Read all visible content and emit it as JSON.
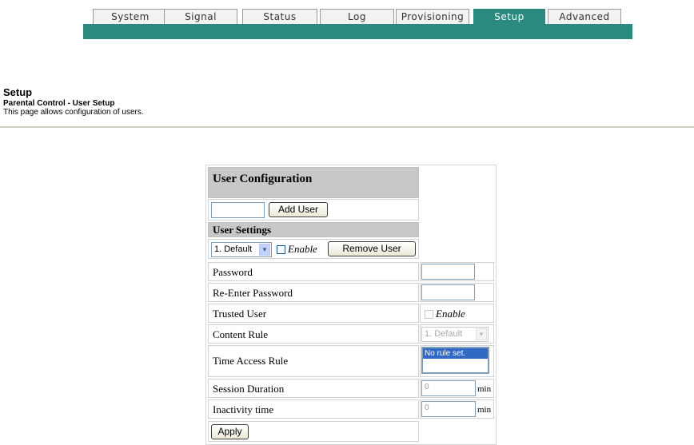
{
  "tabs": [
    {
      "label": "System",
      "active": false
    },
    {
      "label": "Signal",
      "active": false
    },
    {
      "label": "Status",
      "active": false
    },
    {
      "label": "Log",
      "active": false
    },
    {
      "label": "Provisioning",
      "active": false
    },
    {
      "label": "Setup",
      "active": true
    },
    {
      "label": "Advanced",
      "active": false
    }
  ],
  "header": {
    "title": "Setup",
    "subtitle": "Parental Control - User Setup",
    "description": "This page allows configuration of users."
  },
  "form": {
    "user_config_title": "User Configuration",
    "new_user_value": "",
    "add_user_label": "Add User",
    "user_settings_title": "User Settings",
    "selected_user": "1. Default",
    "enable_label": "Enable",
    "remove_user_label": "Remove User",
    "password_label": "Password",
    "reenter_password_label": "Re-Enter Password",
    "trusted_user_label": "Trusted User",
    "trusted_enable_label": "Enable",
    "content_rule_label": "Content Rule",
    "content_rule_value": "1. Default",
    "time_access_label": "Time Access Rule",
    "time_access_option": "No rule set.",
    "session_duration_label": "Session Duration",
    "session_duration_value": "0",
    "session_unit": "min",
    "inactivity_label": "Inactivity time",
    "inactivity_value": "0",
    "inactivity_unit": "min",
    "apply_label": "Apply"
  },
  "colors": {
    "tab_accent": "#2a8a80",
    "section_header_gray": "#c8c8c8",
    "selected_option": "#316ac5"
  }
}
